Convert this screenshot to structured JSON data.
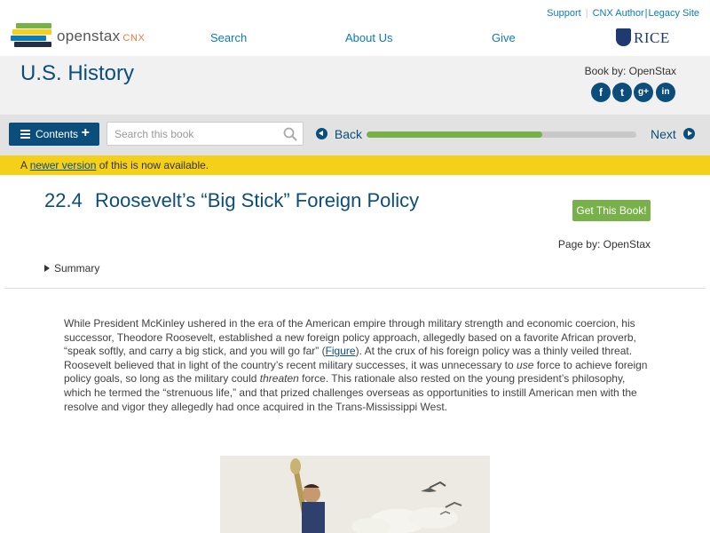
{
  "header": {
    "logo_text": "openstax",
    "logo_suffix": "CNX",
    "util_links": [
      "Support",
      "CNX Author",
      "Legacy Site"
    ],
    "nav": [
      "Search",
      "About Us",
      "Give"
    ],
    "partner_logo": "RICE"
  },
  "book": {
    "title": "U.S. History",
    "book_by": "Book by: OpenStax",
    "social_icons": [
      "facebook-icon",
      "twitter-icon",
      "google-plus-icon",
      "linkedin-icon"
    ]
  },
  "toolbar": {
    "contents_label": "Contents",
    "search_placeholder": "Search this book",
    "back_label": "Back",
    "next_label": "Next",
    "progress_fraction": 0.65
  },
  "notice": {
    "prefix": "A ",
    "link": "newer version",
    "suffix": " of this is now available."
  },
  "page": {
    "section_number": "22.4",
    "section_title": "Roosevelt’s “Big Stick” Foreign Policy",
    "get_book_label": "Get This Book!",
    "page_by": "Page by: OpenStax",
    "summary_label": "Summary"
  },
  "content": {
    "p1_a": "While President McKinley ushered in the era of the American empire through military strength and economic coercion, his successor, Theodore Roosevelt, established a new foreign policy approach, allegedly based on a favorite African proverb, “speak softly, and carry a big stick, and you will go far” (",
    "p1_link": "Figure",
    "p1_b": "). At the crux of his foreign policy was a thinly veiled threat. Roosevelt believed that in light of the country’s recent military successes, it was unnecessary to ",
    "p1_em1": "use",
    "p1_c": " force to achieve foreign policy goals, so long as the military could ",
    "p1_em2": "threaten",
    "p1_d": " force. This rationale also rested on the young president’s philosophy, which he termed the “strenuous life,” and that prized challenges overseas as opportunities to instill American men with the resolve and vigor they allegedly had once acquired in the Trans-Mississippi West."
  },
  "colors": {
    "brand_blue": "#0c4e7b",
    "link_blue": "#0c7bb8",
    "progress_green": "#78b04a",
    "notice_yellow": "#f4d019"
  }
}
